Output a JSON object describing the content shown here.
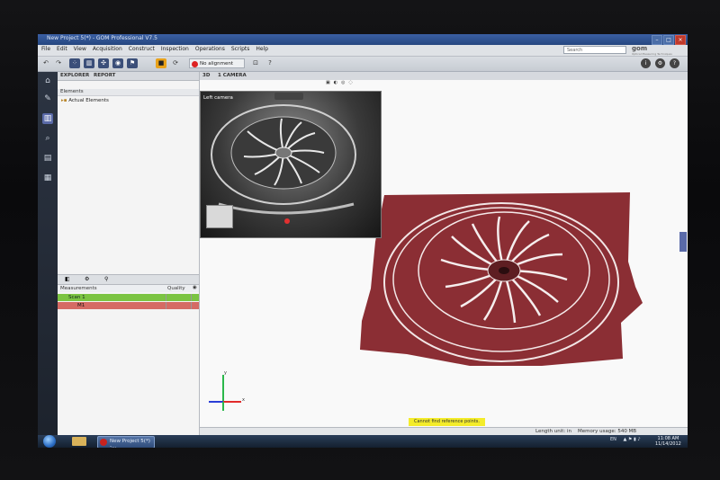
{
  "window": {
    "title": "New Project 5(*) - GOM Professional V7.5"
  },
  "menu": [
    "File",
    "Edit",
    "View",
    "Acquisition",
    "Construct",
    "Inspection",
    "Operations",
    "Scripts",
    "Help"
  ],
  "search": {
    "placeholder": "Search"
  },
  "logo": {
    "brand": "gom",
    "tagline": "Optical Measuring Techniques"
  },
  "toolbar": {
    "alignment": "No alignment"
  },
  "explorer": {
    "tabs": [
      "EXPLORER",
      "REPORT"
    ],
    "elements_header": "Elements",
    "actual_elements": "Actual Elements",
    "measurements_header": "Measurements",
    "quality_header": "Quality",
    "rows": [
      {
        "label": "Scan 1"
      },
      {
        "label": "M1"
      }
    ]
  },
  "viewport": {
    "tabs": [
      "3D",
      "1 CAMERA"
    ],
    "camera_label": "Left camera",
    "message": "Cannot find reference points.",
    "axes": {
      "x": "x",
      "y": "y"
    }
  },
  "statusbar": {
    "length_unit": "Length unit: in",
    "memory": "Memory usage: 540 MB"
  },
  "taskbar": {
    "app_label": "New Project 5(*) -...",
    "lang": "EN",
    "time": "11:08 AM",
    "date": "11/14/2012"
  },
  "colors": {
    "scan": "#8b2e34",
    "accent": "#3b4f79",
    "warning": "#f4ec2a"
  }
}
